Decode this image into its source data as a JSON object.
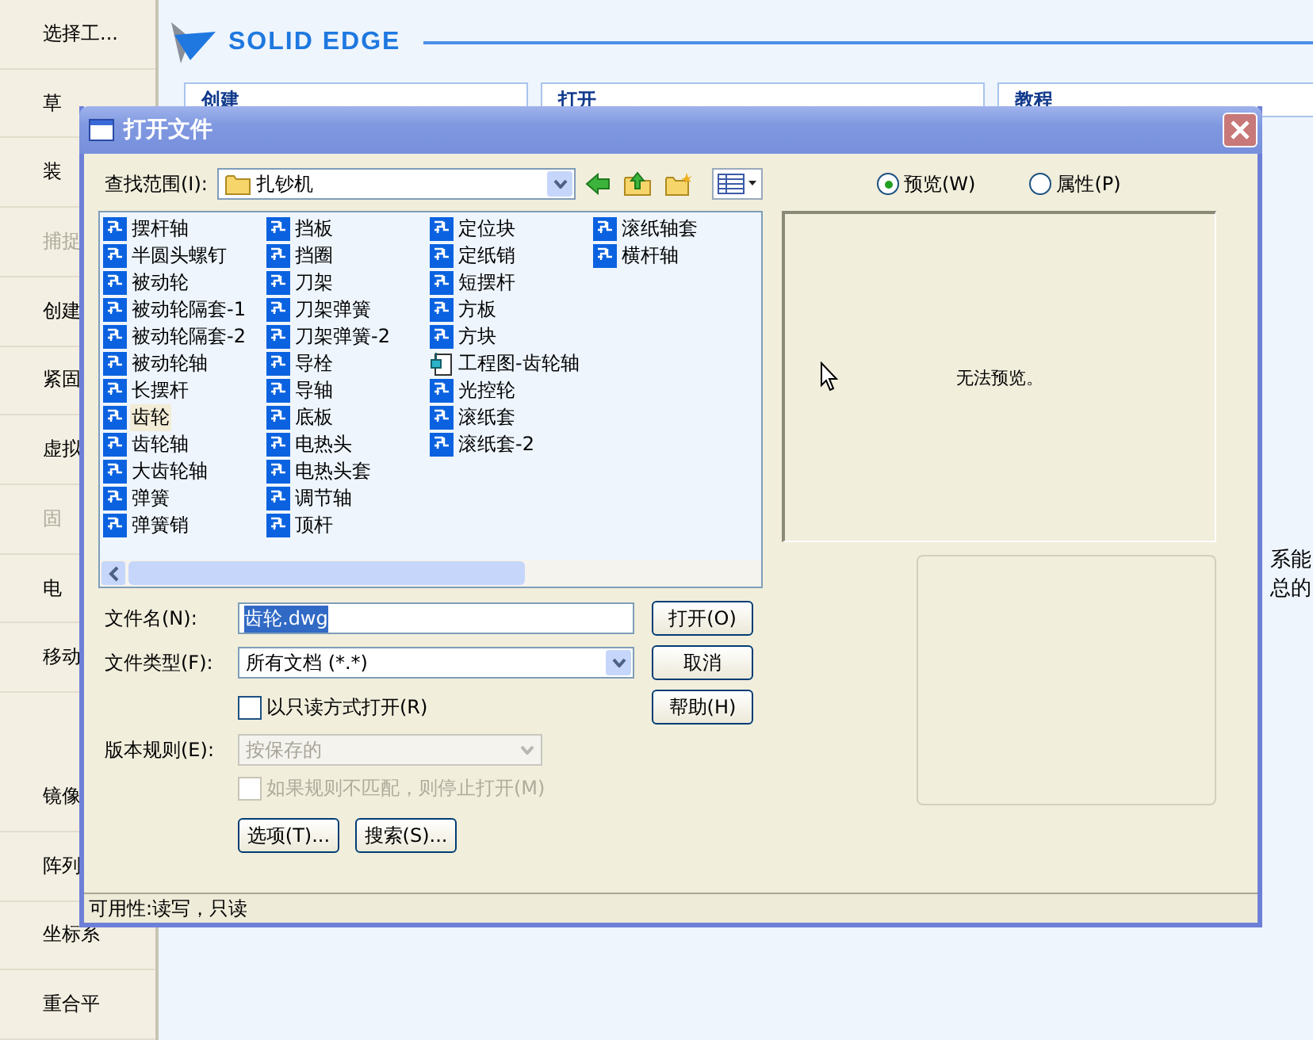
{
  "toolbar": {
    "items": [
      {
        "label": "选择工...",
        "disabled": false
      },
      {
        "label": "草",
        "disabled": false
      },
      {
        "label": "装",
        "disabled": false
      },
      {
        "label": "捕捉",
        "disabled": true
      },
      {
        "label": "创建",
        "disabled": false
      },
      {
        "label": "紧固",
        "disabled": false
      },
      {
        "label": "虚拟",
        "disabled": false
      },
      {
        "label": "固",
        "disabled": true
      },
      {
        "label": "电",
        "disabled": false
      },
      {
        "label": "移动",
        "disabled": false
      },
      {
        "label": "镜像",
        "disabled": false
      },
      {
        "label": "阵列",
        "disabled": false
      },
      {
        "label": "坐标系",
        "disabled": false
      },
      {
        "label": "重合平",
        "disabled": false
      }
    ]
  },
  "logo": {
    "text": "SOLID EDGE"
  },
  "sections": [
    {
      "title": "创建"
    },
    {
      "title": "打开"
    },
    {
      "title": "教程"
    }
  ],
  "side_text": [
    "系能",
    "总的"
  ],
  "dialog": {
    "title": "打开文件",
    "look_in": {
      "label": "查找范围(I):",
      "value": "扎钞机"
    },
    "file_list": {
      "columns": [
        [
          {
            "name": "摆杆轴",
            "kind": "part",
            "selected": false
          },
          {
            "name": "半圆头螺钉",
            "kind": "part",
            "selected": false
          },
          {
            "name": "被动轮",
            "kind": "part",
            "selected": false
          },
          {
            "name": "被动轮隔套-1",
            "kind": "part",
            "selected": false
          },
          {
            "name": "被动轮隔套-2",
            "kind": "part",
            "selected": false
          },
          {
            "name": "被动轮轴",
            "kind": "part",
            "selected": false
          },
          {
            "name": "长摆杆",
            "kind": "part",
            "selected": false
          },
          {
            "name": "齿轮",
            "kind": "part",
            "selected": true
          },
          {
            "name": "齿轮轴",
            "kind": "part",
            "selected": false
          },
          {
            "name": "大齿轮轴",
            "kind": "part",
            "selected": false
          },
          {
            "name": "弹簧",
            "kind": "part",
            "selected": false
          },
          {
            "name": "弹簧销",
            "kind": "part",
            "selected": false
          }
        ],
        [
          {
            "name": "挡板",
            "kind": "part",
            "selected": false
          },
          {
            "name": "挡圈",
            "kind": "part",
            "selected": false
          },
          {
            "name": "刀架",
            "kind": "part",
            "selected": false
          },
          {
            "name": "刀架弹簧",
            "kind": "part",
            "selected": false
          },
          {
            "name": "刀架弹簧-2",
            "kind": "part",
            "selected": false
          },
          {
            "name": "导栓",
            "kind": "part",
            "selected": false
          },
          {
            "name": "导轴",
            "kind": "part",
            "selected": false
          },
          {
            "name": "底板",
            "kind": "part",
            "selected": false
          },
          {
            "name": "电热头",
            "kind": "part",
            "selected": false
          },
          {
            "name": "电热头套",
            "kind": "part",
            "selected": false
          },
          {
            "name": "调节轴",
            "kind": "part",
            "selected": false
          },
          {
            "name": "顶杆",
            "kind": "part",
            "selected": false
          }
        ],
        [
          {
            "name": "定位块",
            "kind": "part",
            "selected": false
          },
          {
            "name": "定纸销",
            "kind": "part",
            "selected": false
          },
          {
            "name": "短摆杆",
            "kind": "part",
            "selected": false
          },
          {
            "name": "方板",
            "kind": "part",
            "selected": false
          },
          {
            "name": "方块",
            "kind": "part",
            "selected": false
          },
          {
            "name": "工程图-齿轮轴",
            "kind": "drawing",
            "selected": false
          },
          {
            "name": "光控轮",
            "kind": "part",
            "selected": false
          },
          {
            "name": "滚纸套",
            "kind": "part",
            "selected": false
          },
          {
            "name": "滚纸套-2",
            "kind": "part",
            "selected": false
          }
        ],
        [
          {
            "name": "滚纸轴套",
            "kind": "part",
            "selected": false
          },
          {
            "name": "横杆轴",
            "kind": "part",
            "selected": false
          }
        ]
      ]
    },
    "file_name": {
      "label": "文件名(N):",
      "value": "齿轮.dwg",
      "value_selected": true
    },
    "file_type": {
      "label": "文件类型(F):",
      "value": "所有文档 (*.*)"
    },
    "read_only": {
      "label": "以只读方式打开(R)",
      "checked": false,
      "disabled": false
    },
    "version_rule": {
      "label": "版本规则(E):",
      "value": "按保存的",
      "disabled": true
    },
    "stop_if_mismatch": {
      "label": "如果规则不匹配，则停止打开(M)",
      "checked": false,
      "disabled": true
    },
    "buttons": [
      {
        "label": "打开(O)"
      },
      {
        "label": "取消"
      },
      {
        "label": "帮助(H)"
      }
    ],
    "bottom_buttons": [
      {
        "label": "选项(T)..."
      },
      {
        "label": "搜索(S)..."
      }
    ],
    "view_options": [
      {
        "label": "预览(W)",
        "selected": true
      },
      {
        "label": "属性(P)",
        "selected": false
      }
    ],
    "preview_message": "无法预览。",
    "status": "可用性:读写，只读"
  }
}
